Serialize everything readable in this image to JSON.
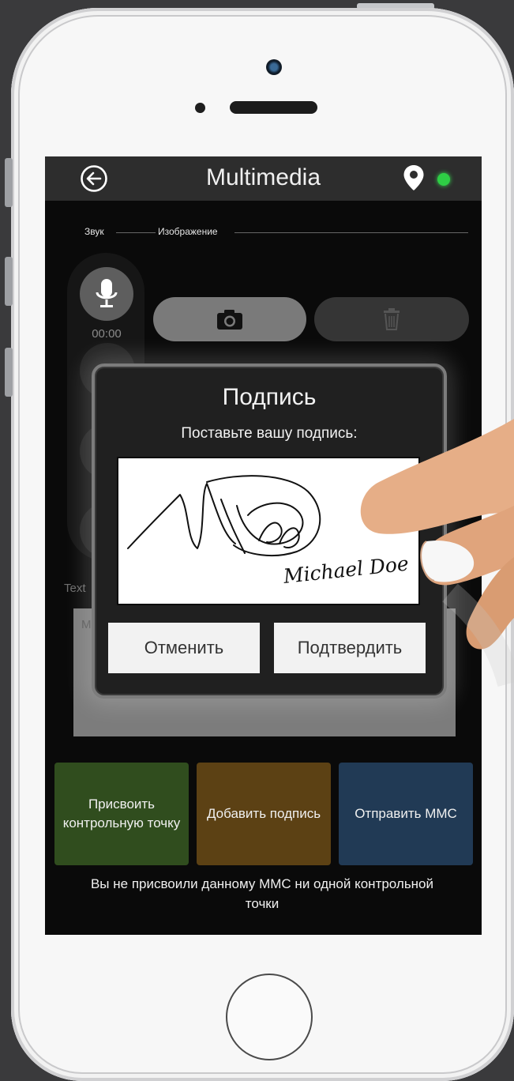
{
  "app": {
    "title": "Multimedia"
  },
  "tabs": {
    "sound": "Звук",
    "image": "Изображение"
  },
  "recorder": {
    "time": "00:00"
  },
  "text_section": {
    "label": "Text",
    "placeholder": "M"
  },
  "actions": {
    "assign_checkpoint": "Присвоить контрольную точку",
    "add_signature": "Добавить подпись",
    "send_mms": "Отправить MMC"
  },
  "warning": "Вы не присвоили данному MMC ни одной контрольной точки",
  "dialog": {
    "title": "Подпись",
    "prompt": "Поставьте вашу подпись:",
    "signature_name": "Michael Doe",
    "cancel": "Отменить",
    "confirm": "Подтвердить"
  },
  "colors": {
    "status_online": "#2ecf45",
    "assign_button": "#304d1e",
    "signature_button": "#5c4114",
    "send_button": "#213a55"
  },
  "icons": [
    "back-arrow-icon",
    "location-pin-icon",
    "microphone-icon",
    "camera-icon",
    "trash-icon"
  ]
}
